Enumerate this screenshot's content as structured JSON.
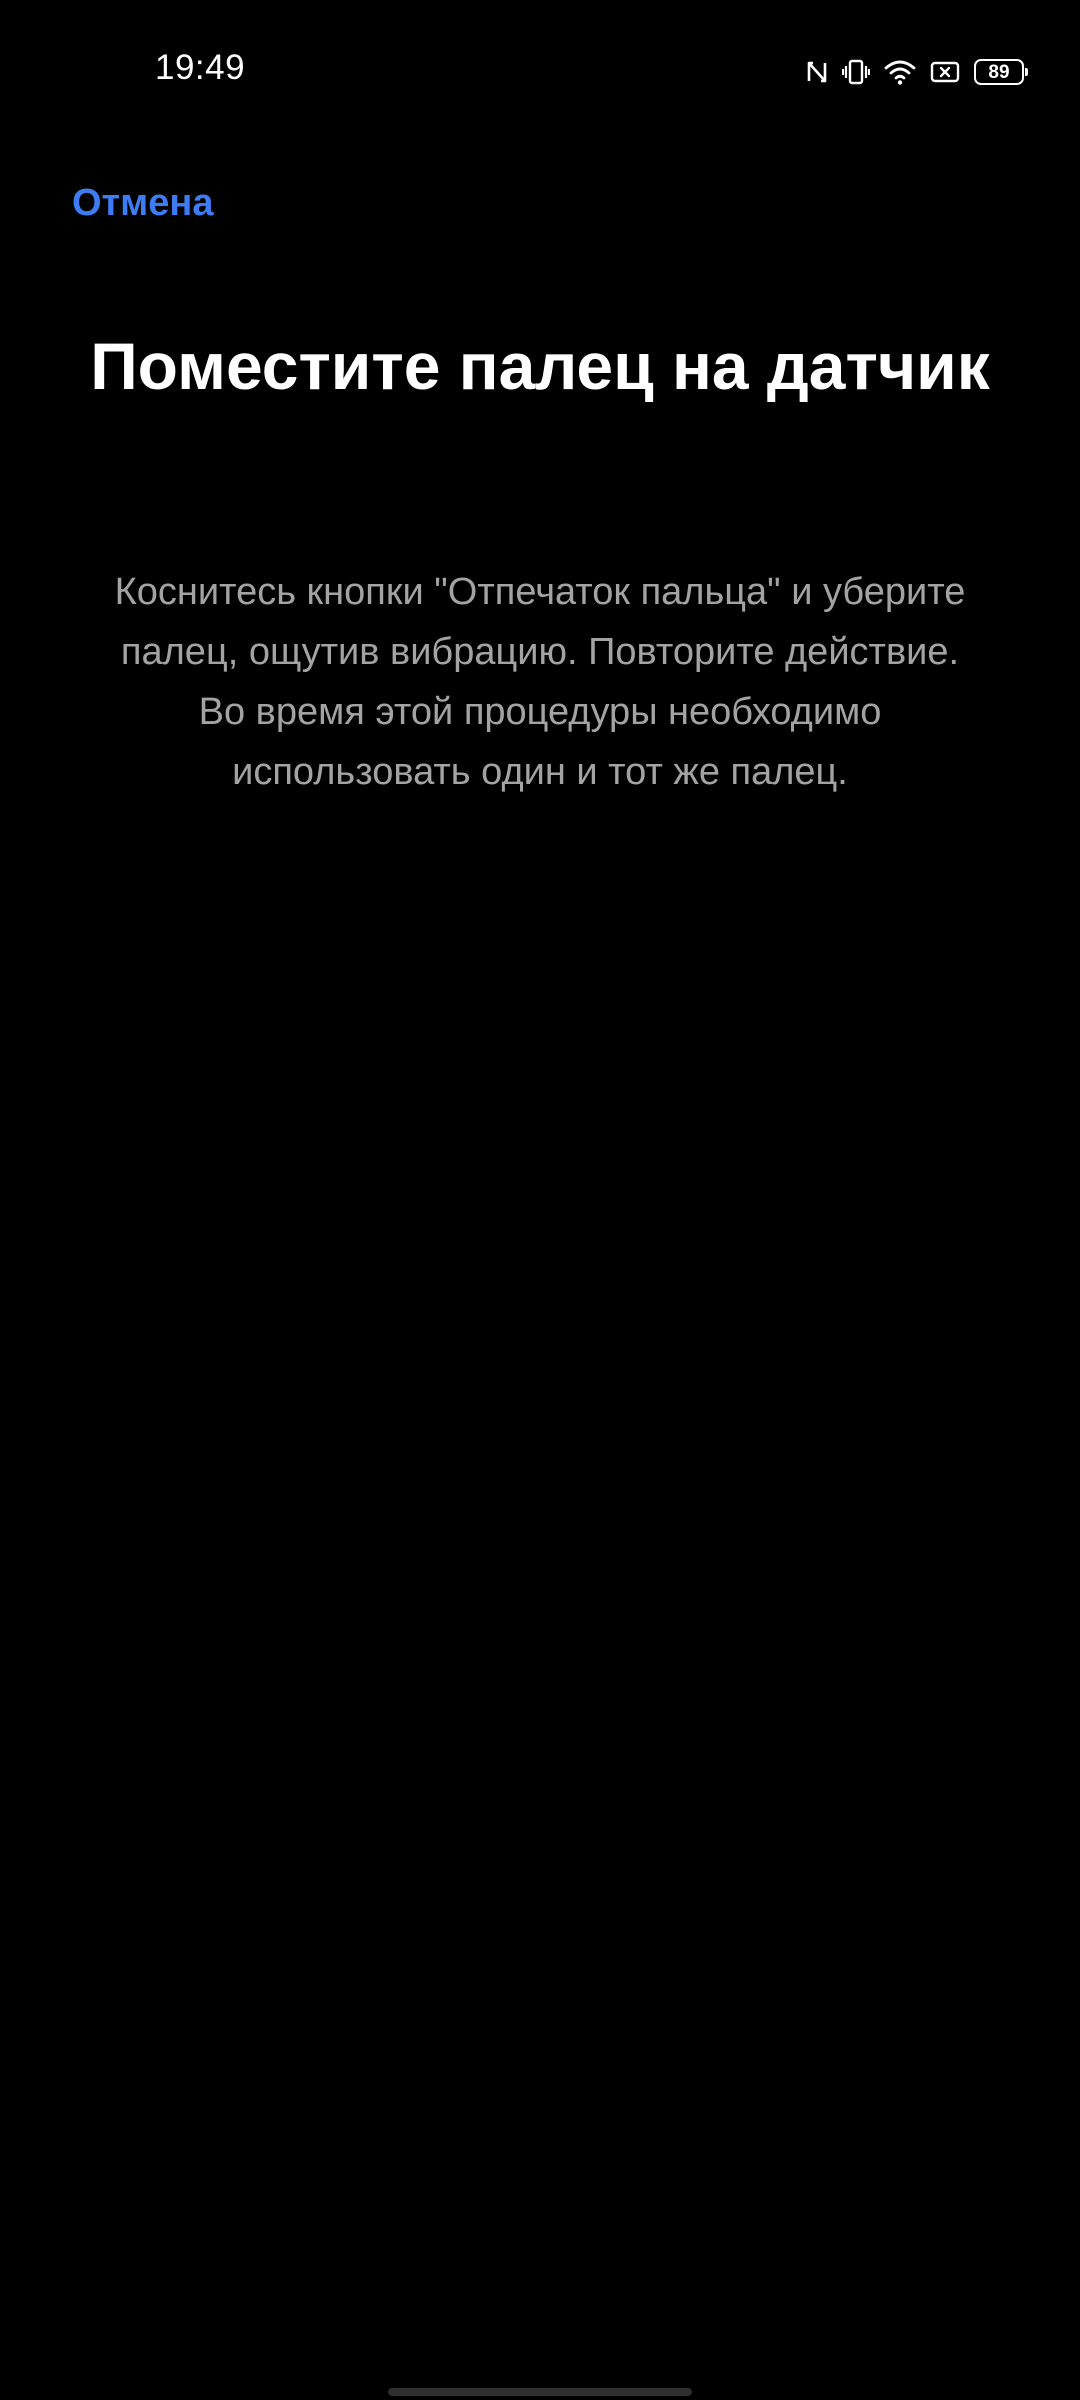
{
  "status_bar": {
    "time": "19:49",
    "battery_level": "89",
    "icons": [
      "nfc-icon",
      "vibrate-icon",
      "wifi-icon",
      "screen-record-icon",
      "battery-icon"
    ]
  },
  "header": {
    "cancel_label": "Отмена"
  },
  "main": {
    "title": "Поместите палец на датчик",
    "instruction_line1": "Коснитесь кнопки \"Отпечаток пальца\" и уберите палец, ощутив вибрацию. Повторите действие.",
    "instruction_line2": "Во время этой процедуры необходимо использовать один и тот же палец."
  },
  "colors": {
    "background": "#000000",
    "accent": "#3d7cf2",
    "title_text": "#ffffff",
    "body_text": "#a3a3a3"
  }
}
